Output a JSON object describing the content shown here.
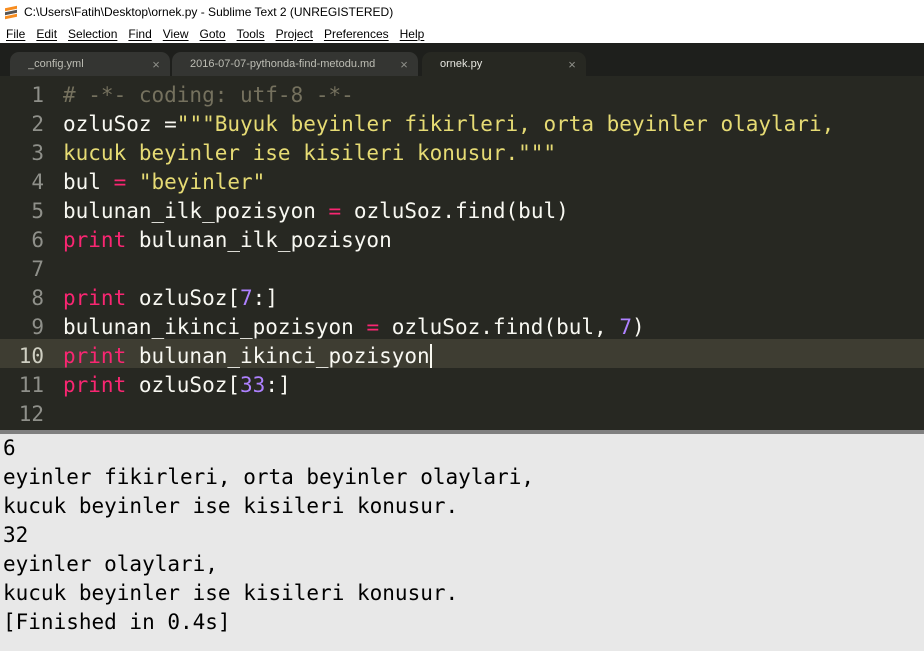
{
  "window": {
    "title": "C:\\Users\\Fatih\\Desktop\\ornek.py - Sublime Text 2 (UNREGISTERED)"
  },
  "menu": [
    "File",
    "Edit",
    "Selection",
    "Find",
    "View",
    "Goto",
    "Tools",
    "Project",
    "Preferences",
    "Help"
  ],
  "tabs": [
    {
      "label": "_config.yml",
      "close": "×",
      "active": false
    },
    {
      "label": "2016-07-07-pythonda-find-metodu.md",
      "close": "×",
      "active": false
    },
    {
      "label": "ornek.py",
      "close": "×",
      "active": true
    }
  ],
  "editor": {
    "line_numbers": [
      "1",
      "2",
      "3",
      "4",
      "5",
      "6",
      "7",
      "8",
      "9",
      "10",
      "11",
      "12"
    ],
    "current_line": "10",
    "lines": {
      "l1": [
        "# -*- coding: utf-8 -*-"
      ],
      "l2": [
        "ozluSoz =",
        "\"\"\"Buyuk beyinler fikirleri, orta beyinler olaylari,"
      ],
      "l3": [
        "kucuk beyinler ise kisileri konusur.\"\"\""
      ],
      "l4": [
        "bul",
        " = ",
        "\"beyinler\""
      ],
      "l5": [
        "bulunan_ilk_pozisyon",
        " = ",
        "ozluSoz.find(bul)"
      ],
      "l6": [
        "print",
        " bulunan_ilk_pozisyon"
      ],
      "l8": [
        "print",
        " ozluSoz[",
        "7",
        ":]"
      ],
      "l9": [
        "bulunan_ikinci_pozisyon",
        " = ",
        "ozluSoz.find(bul, ",
        "7",
        ")"
      ],
      "l10": [
        "print",
        " bulunan_ikinci_pozisyon"
      ],
      "l11": [
        "print",
        " ozluSoz[",
        "33",
        ":]"
      ]
    }
  },
  "output": [
    "6",
    "eyinler fikirleri, orta beyinler olaylari,",
    "kucuk beyinler ise kisileri konusur.",
    "32",
    "eyinler olaylari,",
    "kucuk beyinler ise kisileri konusur.",
    "[Finished in 0.4s]"
  ],
  "colors": {
    "background": "#272822",
    "keyword": "#f92672",
    "string": "#e6db74",
    "number": "#ae81ff",
    "comment": "#75715e",
    "output_background": "#e8e8e8"
  }
}
